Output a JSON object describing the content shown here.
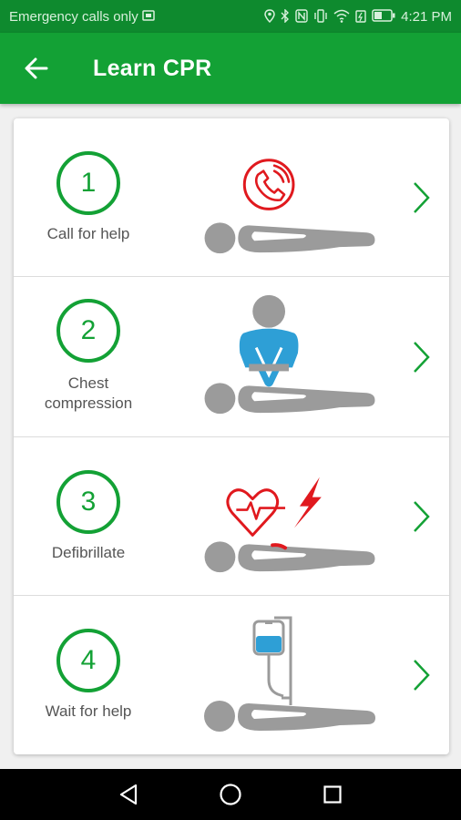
{
  "status_bar": {
    "carrier_text": "Emergency calls only",
    "time": "4:21 PM",
    "icons": [
      "sim-card-icon",
      "location-icon",
      "bluetooth-icon",
      "nfc-icon",
      "vibrate-icon",
      "wifi-icon",
      "battery-saver-icon",
      "battery-icon"
    ]
  },
  "app_bar": {
    "title": "Learn CPR",
    "back_icon": "arrow-left-icon"
  },
  "colors": {
    "accent_green": "#13a135",
    "status_green": "#0e8a2e",
    "alert_red": "#e0191e",
    "rescuer_blue": "#2e9fd6",
    "figure_gray": "#9b9b9b"
  },
  "steps": [
    {
      "number": "1",
      "label": "Call for help",
      "illustration": "phone-call-icon"
    },
    {
      "number": "2",
      "label": "Chest compression",
      "illustration": "chest-compression-icon"
    },
    {
      "number": "3",
      "label": "Defibrillate",
      "illustration": "defibrillator-icon"
    },
    {
      "number": "4",
      "label": "Wait for help",
      "illustration": "iv-drip-icon"
    }
  ],
  "nav_bar": {
    "buttons": [
      "back-triangle-icon",
      "home-circle-icon",
      "recents-square-icon"
    ]
  }
}
